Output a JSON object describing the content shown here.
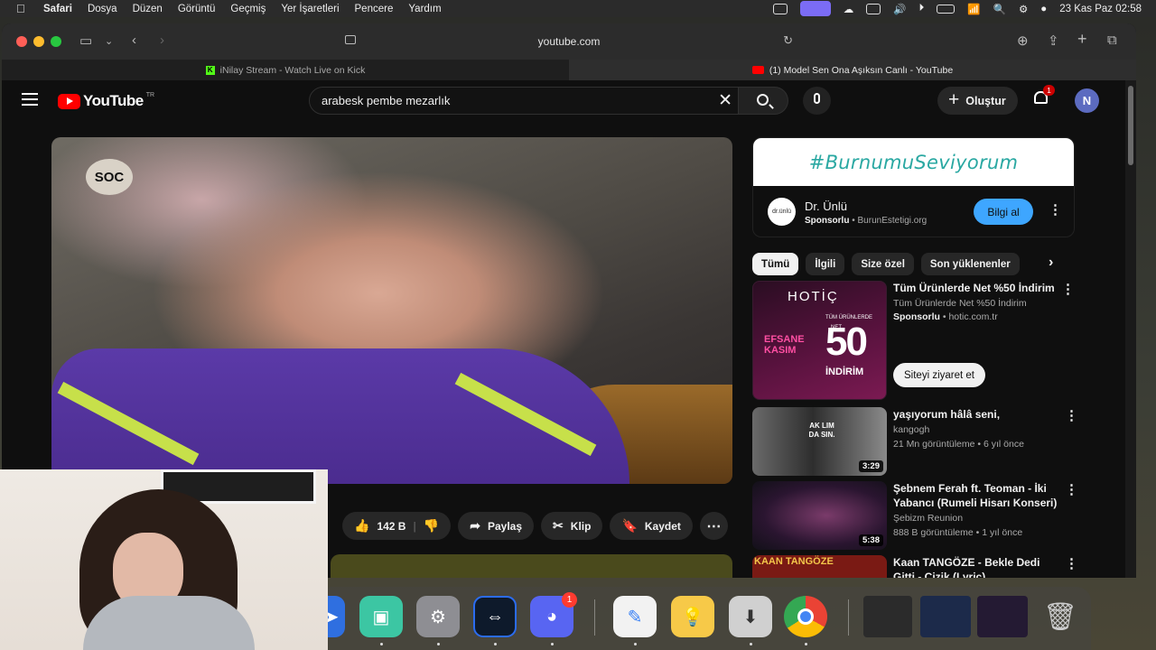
{
  "menubar": {
    "app": "Safari",
    "items": [
      "Dosya",
      "Düzen",
      "Görüntü",
      "Geçmiş",
      "Yer İşaretleri",
      "Pencere",
      "Yardım"
    ],
    "clock": "23 Kas Paz  02:58"
  },
  "browser": {
    "address": "youtube.com",
    "tabs": [
      {
        "title": "iNilay Stream - Watch Live on Kick",
        "favicon": "kick-icon"
      },
      {
        "title": "(1) Model Sen Ona Aşıksın Canlı - YouTube",
        "favicon": "youtube-icon"
      }
    ]
  },
  "youtube": {
    "logo_text": "YouTube",
    "country": "TR",
    "search_value": "arabesk pembe mezarlık",
    "create_label": "Oluştur",
    "notification_count": "1",
    "avatar_letter": "N",
    "video_watermark": "SOC",
    "actions": {
      "likes": "142 B",
      "share": "Paylaş",
      "clip": "Klip",
      "save": "Kaydet"
    },
    "ad": {
      "banner": "#BurnumuSeviyorum",
      "logo_text": "dr.ünlü",
      "title": "Dr. Ünlü",
      "sponsored": "Sponsorlu",
      "domain": "BurunEstetigi.org",
      "cta": "Bilgi al"
    },
    "chips": [
      "Tümü",
      "İlgili",
      "Size özel",
      "Son yüklenenler"
    ],
    "recommendations": [
      {
        "title": "Tüm Ürünlerde Net %50 İndirim",
        "channel": "Tüm Ürünlerde Net %50 İndirim",
        "sponsored": "Sponsorlu",
        "domain": "hotic.com.tr",
        "cta": "Siteyi ziyaret et",
        "thumb_brand": "HOTİÇ",
        "thumb_line1": "EFSANE",
        "thumb_line2": "KASIM",
        "thumb_number": "50",
        "thumb_label": "İNDİRİM",
        "thumb_small": "TÜM ÜRÜNLERDE",
        "thumb_net": "NET"
      },
      {
        "title": "yaşıyorum hâlâ seni,",
        "channel": "kangogh",
        "meta": "21 Mn görüntüleme • 6 yıl önce",
        "duration": "3:29",
        "thumb_text": "AK LIM DA SIN."
      },
      {
        "title": "Şebnem Ferah ft. Teoman - İki Yabancı (Rumeli Hisarı Konseri)",
        "channel": "Şebizm Reunion",
        "meta": "888 B görüntüleme • 1 yıl önce",
        "duration": "5:38"
      },
      {
        "title": "Kaan TANGÖZE - Bekle Dedi Gitti - Cizik (Lyric)",
        "thumb_text": "KAAN TANGÖZE"
      }
    ]
  },
  "colors": {
    "yt_red": "#ff0000",
    "yt_bg": "#0f0f0f",
    "chip_bg": "#272727",
    "accent_blue": "#3ea6ff",
    "ad_teal": "#2aa8a2",
    "badge_red": "#cc0000"
  },
  "dock": {
    "discord_badge": "1"
  }
}
